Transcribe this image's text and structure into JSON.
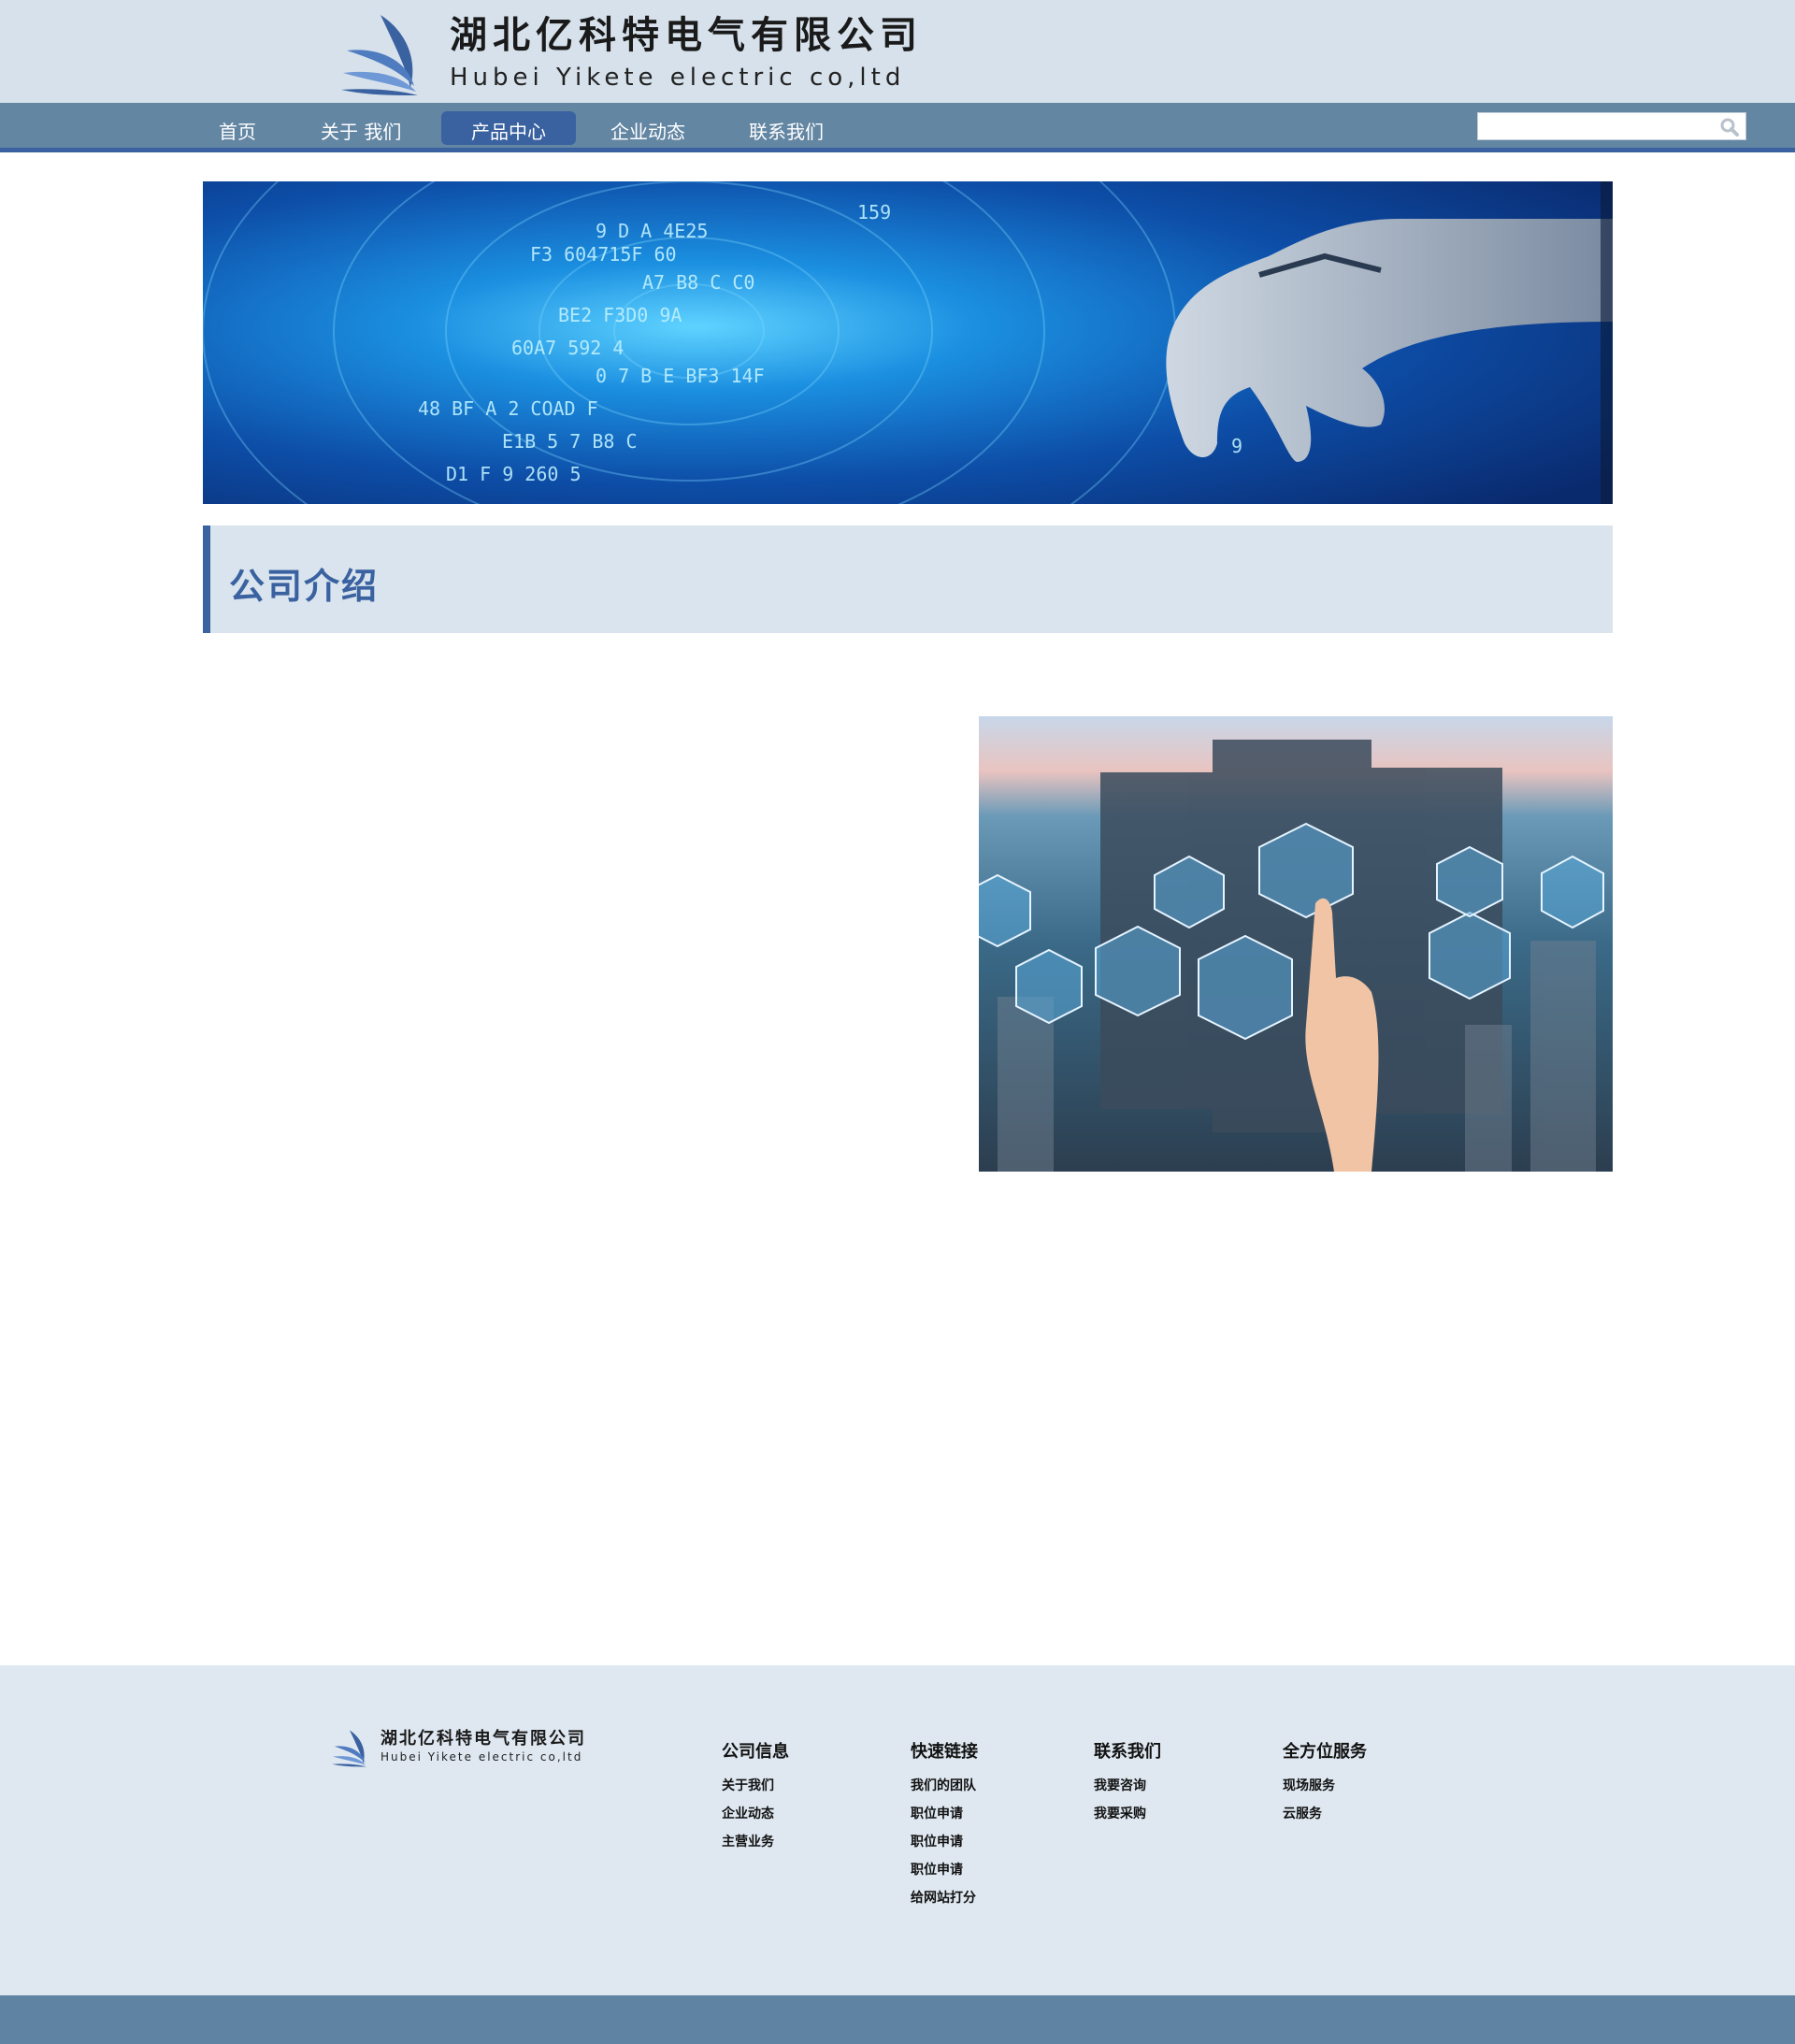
{
  "header": {
    "logo_cn": "湖北亿科特电气有限公司",
    "logo_en": "Hubei Yikete electric co,ltd"
  },
  "nav": {
    "items": [
      {
        "label": "首页"
      },
      {
        "label": "关于 我们"
      },
      {
        "label": "产品中心",
        "active": true
      },
      {
        "label": "企业动态"
      },
      {
        "label": "联系我们"
      }
    ],
    "search_placeholder": ""
  },
  "section": {
    "title": "公司介绍"
  },
  "footer": {
    "logo_cn": "湖北亿科特电气有限公司",
    "logo_en": "Hubei Yikete electric co,ltd",
    "columns": [
      {
        "title": "公司信息",
        "links": [
          "关于我们",
          "企业动态",
          "主营业务"
        ]
      },
      {
        "title": "快速链接",
        "links": [
          "我们的团队",
          "职位申请",
          "职位申请",
          "职位申请",
          "给网站打分"
        ]
      },
      {
        "title": "联系我们",
        "links": [
          "我要咨询",
          "我要采购"
        ]
      },
      {
        "title": "全方位服务",
        "links": [
          "现场服务",
          "云服务"
        ]
      }
    ]
  },
  "colors": {
    "header_bg": "#d6e1eb",
    "nav_bg": "#6386a3",
    "accent": "#3a62a0",
    "footer_bg": "#dfe8f1"
  }
}
